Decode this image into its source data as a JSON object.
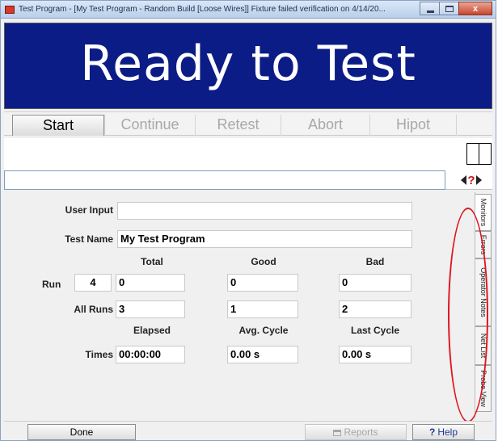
{
  "window": {
    "title": "Test Program - [My Test Program - Random Build [Loose Wires]] Fixture failed verification on 4/14/20...",
    "icon": "app-icon",
    "controls": [
      "minimize-icon",
      "maximize-icon",
      "close-icon"
    ],
    "close_glyph": "x"
  },
  "banner": {
    "text": "Ready to Test",
    "background": "#0c1c86",
    "color": "#ffffff"
  },
  "actions": {
    "start": "Start",
    "continue": "Continue",
    "retest": "Retest",
    "abort": "Abort",
    "hipot": "Hipot"
  },
  "help_nav": {
    "help_glyph": "?"
  },
  "form": {
    "user_input_label": "User Input",
    "user_input_value": "",
    "test_name_label": "Test Name",
    "test_name_value": "My Test Program",
    "col_total": "Total",
    "col_good": "Good",
    "col_bad": "Bad",
    "run_label": "Run",
    "run_number": "4",
    "run_total": "0",
    "run_good": "0",
    "run_bad": "0",
    "allruns_label": "All Runs",
    "allruns_total": "3",
    "allruns_good": "1",
    "allruns_bad": "2",
    "col_elapsed": "Elapsed",
    "col_avg_cycle": "Avg. Cycle",
    "col_last_cycle": "Last Cycle",
    "times_label": "Times",
    "times_elapsed": "00:00:00",
    "times_avg_cycle": "0.00 s",
    "times_last_cycle": "0.00 s"
  },
  "side_tabs": [
    "Monitors",
    "Errors",
    "Operator Notes",
    "Net List",
    "Probe View"
  ],
  "footer": {
    "done": "Done",
    "reports": "Reports",
    "help": "Help",
    "help_glyph": "?"
  },
  "annotation_color": "#e0161f"
}
